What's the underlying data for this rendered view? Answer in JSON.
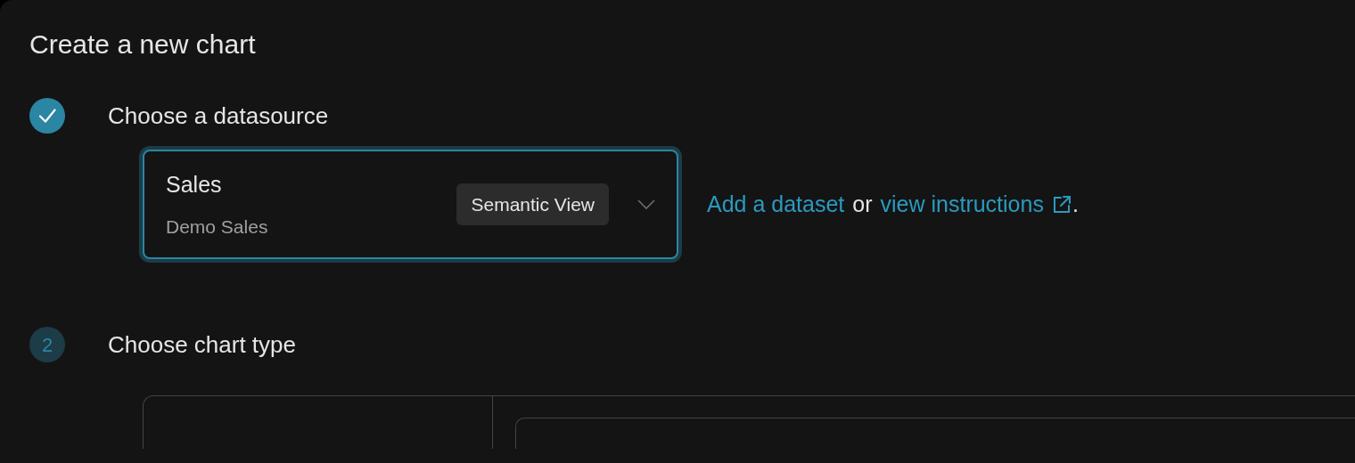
{
  "title": "Create a new chart",
  "steps": [
    {
      "label": "Choose a datasource",
      "completed": true
    },
    {
      "label": "Choose chart type",
      "completed": false,
      "number": "2"
    }
  ],
  "datasource": {
    "name": "Sales",
    "subtitle": "Demo Sales",
    "badge": "Semantic View",
    "focused": true
  },
  "help": {
    "link_1": "Add a dataset",
    "separator": "or",
    "link_2": "view instructions",
    "end": "."
  }
}
